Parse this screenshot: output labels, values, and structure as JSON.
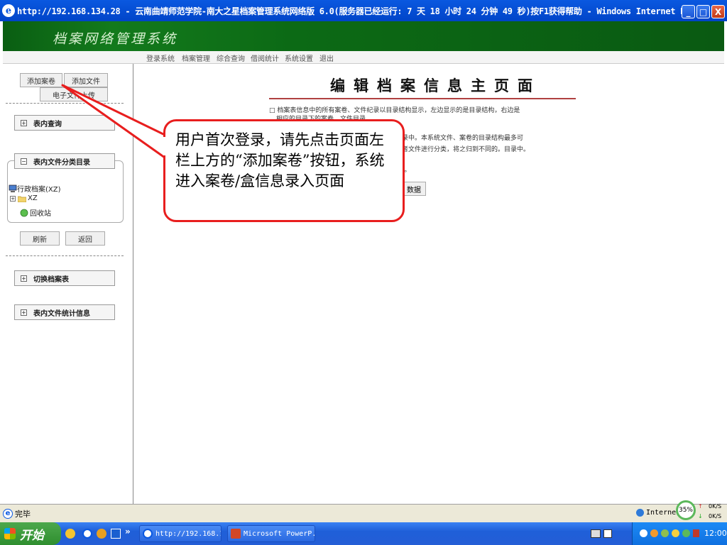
{
  "window": {
    "title": "http://192.168.134.28 - 云南曲靖师范学院-南大之星档案管理系统网络版 6.0(服务器已经运行: 7 天 18 小时 24 分钟 49 秒)按F1获得帮助 - Windows Internet Explorer",
    "minimize_label": "_",
    "maximize_label": "□",
    "close_label": "X"
  },
  "app": {
    "logo": "档案网络管理系统",
    "menu": [
      "登录系统",
      "档案管理",
      "综合查询",
      "借阅统计",
      "系统设置",
      "退出"
    ]
  },
  "sidebar": {
    "add_volume_label": "添加案卷",
    "add_file_label": "添加文件",
    "e_file_label": "电子文件上传",
    "table_query_label": "表内查询",
    "catalog_label": "表内文件分类目录",
    "tree": {
      "root": "行政档案(XZ)",
      "child": "XZ",
      "recycle": "回收站"
    },
    "refresh_label": "刷新",
    "back_label": "返回",
    "switch_label": "切换档案表",
    "stats_label": "表内文件统计信息",
    "plus": "+",
    "minus": "−"
  },
  "main": {
    "title": "编辑档案信息主页面",
    "line1": "□ 档案表信息中的所有案卷、文件纪录以目录结构显示，左边显示的是目录结构，右边是",
    "line2": "相应的目录下的案卷、文件目录。",
    "line3": "录中。本系统文件、案卷的目录结构最多可",
    "line4": "者文件进行分类，将之归到不同的。目录中。",
    "line5": "]。",
    "data_button": "数据"
  },
  "callout": {
    "text": "用户首次登录，请先点击页面左栏上方的“添加案卷”按钮，系统进入案卷/盒信息录入页面"
  },
  "statusbar": {
    "status": "完毕",
    "zone": "Internet",
    "net_percent": "35%",
    "up_speed": "0K/S",
    "down_speed": "0K/S"
  },
  "taskbar": {
    "start_label": "开始",
    "more": "»",
    "tasks": [
      "http://192.168.1...",
      "Microsoft PowerP..."
    ],
    "clock": "12:00"
  },
  "colors": {
    "callout_border": "#e81e1e",
    "header_green": "#137a1c",
    "title_rule": "#b04040"
  }
}
